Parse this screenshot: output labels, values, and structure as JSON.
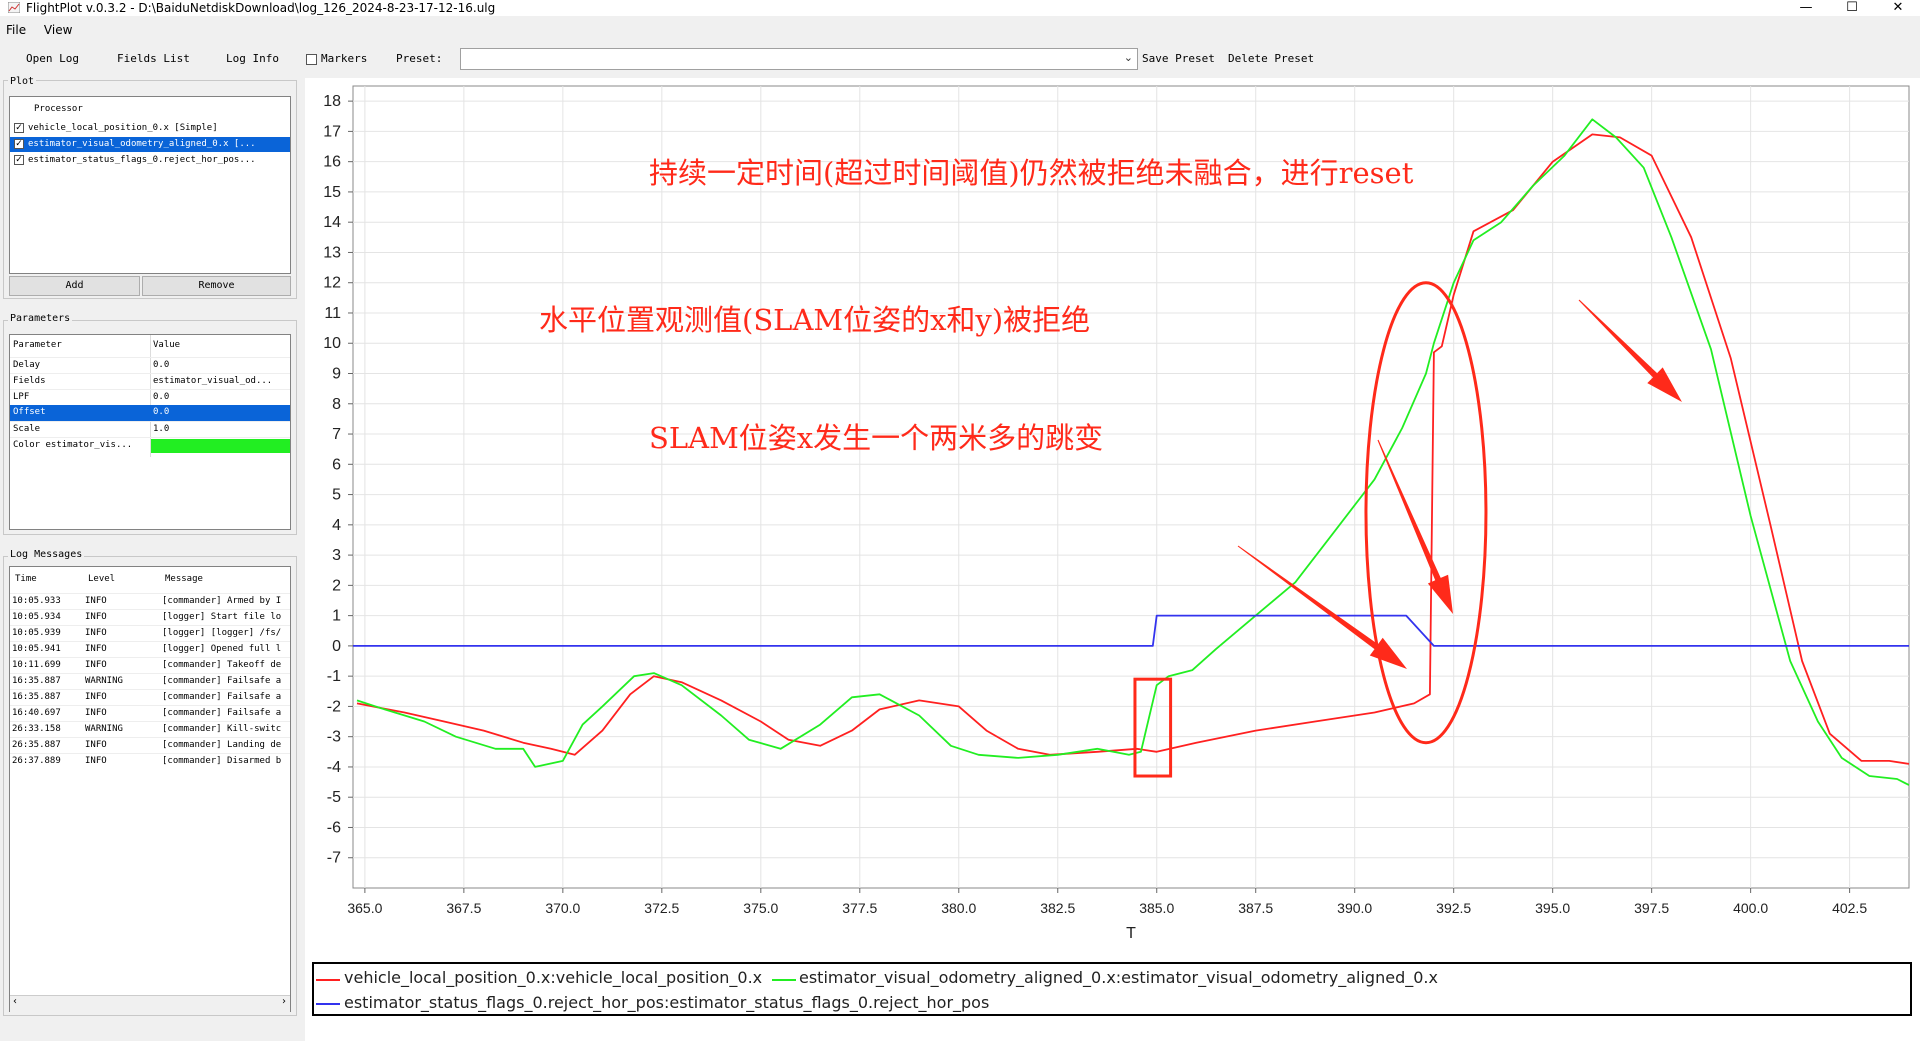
{
  "window": {
    "title": "FlightPlot v.0.3.2 - D:\\BaiduNetdiskDownload\\log_126_2024-8-23-17-12-16.ulg",
    "minimize_glyph": "—",
    "maximize_glyph": "☐",
    "close_glyph": "✕"
  },
  "menu": {
    "file": "File",
    "view": "View"
  },
  "toolbar": {
    "open_log": "Open Log",
    "fields_list": "Fields List",
    "log_info": "Log Info",
    "markers": "Markers",
    "preset": "Preset:",
    "preset_value": "",
    "save_preset": "Save Preset",
    "delete_preset": "Delete Preset"
  },
  "plot_panel": {
    "title": "Plot",
    "header": "Processor",
    "rows": [
      {
        "label": "vehicle_local_position_0.x [Simple]",
        "checked": true,
        "selected": false
      },
      {
        "label": "estimator_visual_odometry_aligned_0.x [...",
        "checked": true,
        "selected": true
      },
      {
        "label": "estimator_status_flags_0.reject_hor_pos...",
        "checked": true,
        "selected": false
      }
    ],
    "add": "Add",
    "remove": "Remove"
  },
  "parameters_panel": {
    "title": "Parameters",
    "col_param": "Parameter",
    "col_value": "Value",
    "rows": [
      {
        "name": "Delay",
        "value": "0.0"
      },
      {
        "name": "Fields",
        "value": "estimator_visual_od..."
      },
      {
        "name": "LPF",
        "value": "0.0"
      },
      {
        "name": "Offset",
        "value": "0.0"
      },
      {
        "name": "Scale",
        "value": "1.0"
      },
      {
        "name": "Color estimator_vis...",
        "value": ""
      }
    ],
    "color_swatch": "#22ee22"
  },
  "log_panel": {
    "title": "Log Messages",
    "col_time": "Time",
    "col_level": "Level",
    "col_message": "Message",
    "rows": [
      {
        "time": "10:05.933",
        "level": "INFO",
        "message": "[commander] Armed by I"
      },
      {
        "time": "10:05.934",
        "level": "INFO",
        "message": "[logger] Start file lo"
      },
      {
        "time": "10:05.939",
        "level": "INFO",
        "message": "[logger] [logger] /fs/"
      },
      {
        "time": "10:05.941",
        "level": "INFO",
        "message": "[logger] Opened full l"
      },
      {
        "time": "10:11.699",
        "level": "INFO",
        "message": "[commander] Takeoff de"
      },
      {
        "time": "16:35.887",
        "level": "WARNING",
        "message": "[commander] Failsafe a"
      },
      {
        "time": "16:35.887",
        "level": "INFO",
        "message": "[commander] Failsafe a"
      },
      {
        "time": "16:40.697",
        "level": "INFO",
        "message": "[commander] Failsafe a"
      },
      {
        "time": "26:33.158",
        "level": "WARNING",
        "message": "[commander] Kill-switc"
      },
      {
        "time": "26:35.887",
        "level": "INFO",
        "message": "[commander] Landing de"
      },
      {
        "time": "26:37.889",
        "level": "INFO",
        "message": "[commander] Disarmed b"
      }
    ]
  },
  "annotations": {
    "reset": "持续一定时间(超过时间阈值)仍然被拒绝未融合，进行reset",
    "rejected": "水平位置观测值(SLAM位姿的x和y)被拒绝",
    "jump": "SLAM位姿x发生一个两米多的跳变"
  },
  "colors": {
    "red": "#ff2020",
    "green": "#22ee22",
    "blue": "#3333ee",
    "annotation": "#ff2a1a"
  },
  "chart_data": {
    "type": "line",
    "xlabel": "T",
    "ylabel": "",
    "xlim": [
      364.7,
      404.0
    ],
    "ylim": [
      -8.0,
      18.5
    ],
    "xticks": [
      "365.0",
      "367.5",
      "370.0",
      "372.5",
      "375.0",
      "377.5",
      "380.0",
      "382.5",
      "385.0",
      "387.5",
      "390.0",
      "392.5",
      "395.0",
      "397.5",
      "400.0",
      "402.5"
    ],
    "yticks": [
      "18",
      "17",
      "16",
      "15",
      "14",
      "13",
      "12",
      "11",
      "10",
      "9",
      "8",
      "7",
      "6",
      "5",
      "4",
      "3",
      "2",
      "1",
      "0",
      "-1",
      "-2",
      "-3",
      "-4",
      "-5",
      "-6",
      "-7"
    ],
    "grid": true,
    "legend_position": "bottom",
    "series": [
      {
        "name": "vehicle_local_position_0.x:vehicle_local_position_0.x",
        "color": "#ff2020",
        "x": [
          364.8,
          366.0,
          367.0,
          368.0,
          369.0,
          369.7,
          370.3,
          371.0,
          371.7,
          372.3,
          373.0,
          374.0,
          375.0,
          375.7,
          376.5,
          377.3,
          378.0,
          379.0,
          380.0,
          380.7,
          381.5,
          382.3,
          383.5,
          384.5,
          385.0,
          386.0,
          387.5,
          389.0,
          390.5,
          391.5,
          391.9,
          392.0,
          392.2,
          392.5,
          393.0,
          394.0,
          395.0,
          396.0,
          396.7,
          397.5,
          398.5,
          399.5,
          400.5,
          401.3,
          402.0,
          402.8,
          403.5,
          404.0
        ],
        "y": [
          -1.9,
          -2.2,
          -2.5,
          -2.8,
          -3.2,
          -3.4,
          -3.6,
          -2.8,
          -1.6,
          -1.0,
          -1.2,
          -1.8,
          -2.5,
          -3.1,
          -3.3,
          -2.8,
          -2.1,
          -1.8,
          -2.0,
          -2.8,
          -3.4,
          -3.6,
          -3.5,
          -3.4,
          -3.5,
          -3.2,
          -2.8,
          -2.5,
          -2.2,
          -1.9,
          -1.6,
          9.7,
          9.9,
          11.6,
          13.7,
          14.4,
          16.0,
          16.9,
          16.8,
          16.2,
          13.5,
          9.5,
          4.0,
          -0.5,
          -2.9,
          -3.8,
          -3.8,
          -3.9
        ]
      },
      {
        "name": "estimator_visual_odometry_aligned_0.x:estimator_visual_odometry_aligned_0.x",
        "color": "#22ee22",
        "x": [
          364.8,
          365.5,
          366.5,
          367.3,
          368.3,
          369.0,
          369.3,
          370.0,
          370.5,
          371.0,
          371.8,
          372.3,
          373.0,
          374.0,
          374.7,
          375.5,
          376.5,
          377.3,
          378.0,
          379.0,
          379.8,
          380.5,
          381.5,
          382.5,
          383.5,
          384.3,
          384.6,
          385.0,
          385.3,
          385.9,
          386.5,
          387.5,
          388.5,
          389.5,
          390.5,
          391.2,
          391.8,
          392.0,
          392.5,
          393.0,
          393.7,
          394.5,
          395.3,
          396.0,
          396.6,
          397.3,
          398.0,
          399.0,
          400.0,
          401.0,
          401.7,
          402.3,
          403.0,
          403.7,
          404.0
        ],
        "y": [
          -1.8,
          -2.1,
          -2.5,
          -3.0,
          -3.4,
          -3.4,
          -4.0,
          -3.8,
          -2.6,
          -2.0,
          -1.0,
          -0.9,
          -1.3,
          -2.3,
          -3.1,
          -3.4,
          -2.6,
          -1.7,
          -1.6,
          -2.3,
          -3.3,
          -3.6,
          -3.7,
          -3.6,
          -3.4,
          -3.6,
          -3.5,
          -1.3,
          -1.0,
          -0.8,
          -0.1,
          1.0,
          2.1,
          3.8,
          5.5,
          7.2,
          9.0,
          10.0,
          12.0,
          13.4,
          14.0,
          15.2,
          16.2,
          17.4,
          16.8,
          15.8,
          13.5,
          9.8,
          4.3,
          -0.5,
          -2.5,
          -3.7,
          -4.3,
          -4.4,
          -4.6
        ]
      },
      {
        "name": "estimator_status_flags_0.reject_hor_pos:estimator_status_flags_0.reject_hor_pos",
        "color": "#3333ee",
        "x": [
          364.7,
          384.9,
          385.0,
          391.3,
          392.0,
          404.0
        ],
        "y": [
          0,
          0,
          1,
          1,
          0,
          0
        ]
      }
    ]
  }
}
